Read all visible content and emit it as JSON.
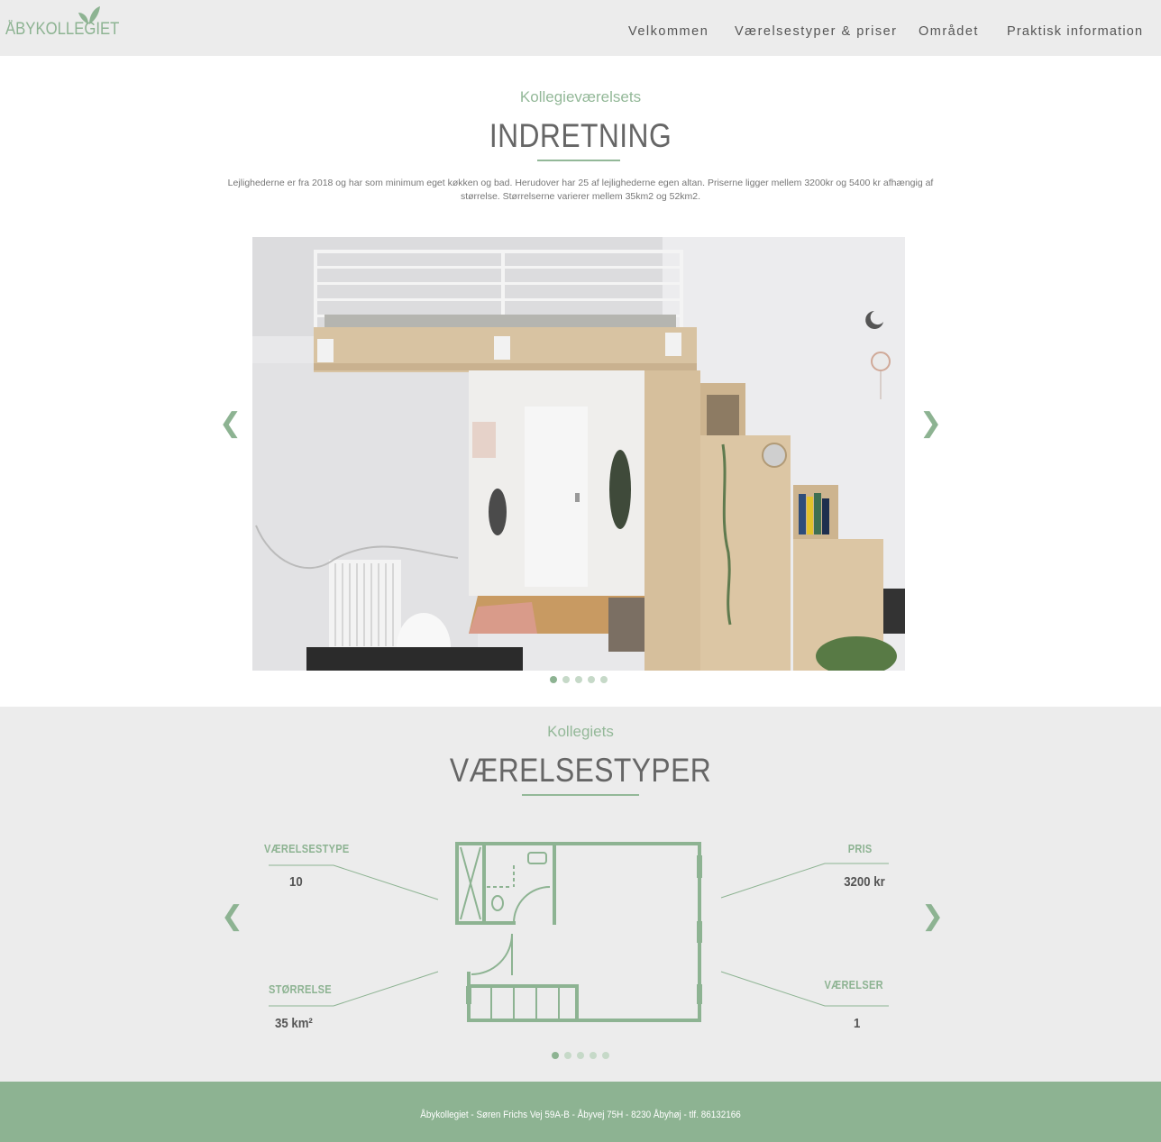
{
  "header": {
    "logo_text": "ÅBYKOLLEGIET",
    "nav": [
      {
        "label": "Velkommen"
      },
      {
        "label": "Værelsestyper & priser"
      },
      {
        "label": "Området"
      },
      {
        "label": "Praktisk information"
      }
    ]
  },
  "interior": {
    "subtitle": "Kollegieværelsets",
    "title": "INDRETNING",
    "description": "Lejlighederne er fra 2018 og har som minimum eget køkken og bad. Herudover har 25 af lejlighederne egen altan. Priserne ligger mellem 3200kr og 5400 kr afhængig af størrelse. Størrelserne varierer mellem 35km2 og 52km2.",
    "prev_arrow": "❮",
    "next_arrow": "❯",
    "slide_count": 5,
    "active_slide": 1
  },
  "room_types": {
    "subtitle": "Kollegiets",
    "title": "VÆRELSESTYPER",
    "prev_arrow": "❮",
    "next_arrow": "❯",
    "labels": {
      "type": "VÆRELSESTYPE",
      "price": "PRIS",
      "size": "STØRRELSE",
      "rooms": "VÆRELSER"
    },
    "values": {
      "type": "10",
      "price": "3200 kr",
      "size": "35 km²",
      "rooms": "1"
    },
    "slide_count": 5,
    "active_slide": 1
  },
  "footer": {
    "text": "Åbykollegiet - Søren Frichs Vej 59A-B - Åbyvej 75H - 8230 Åbyhøj - tlf. 86132166"
  },
  "colors": {
    "accent": "#8db392",
    "header_bg": "#ececec",
    "text": "#666666"
  }
}
